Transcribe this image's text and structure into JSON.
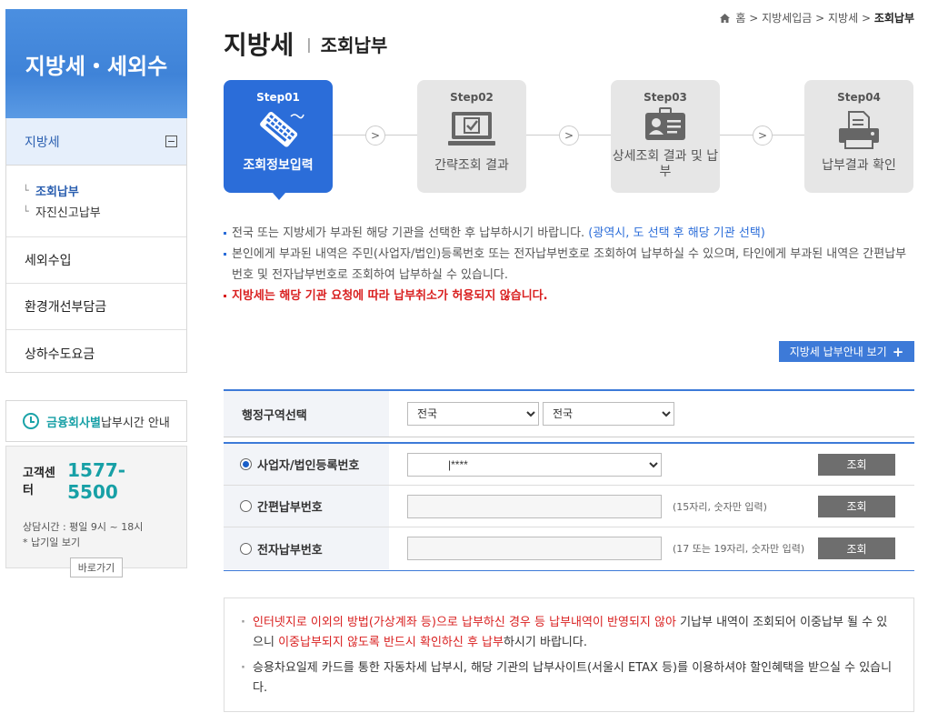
{
  "sidebar": {
    "heading": "지방세・세외수",
    "main_item": "지방세",
    "sub_items": [
      "조회납부",
      "자진신고납부"
    ],
    "links": [
      "세외수입",
      "환경개선부담금",
      "상하수도요금"
    ],
    "notice_strong": "금융회사별",
    "notice_rest": " 납부시간 안내",
    "cs_label": "고객센터",
    "cs_phone": "1577-5500",
    "cs_hours": "상담시간 : 평일 9시 ~ 18시",
    "cs_holiday": "* 납기일 보기",
    "cs_button": "바로가기"
  },
  "breadcrumb": {
    "home": "홈",
    "sep": " > ",
    "items": [
      "지방세입금",
      "지방세"
    ],
    "current": "조회납부"
  },
  "title": {
    "main": "지방세",
    "sub": "조회납부"
  },
  "steps": [
    {
      "label": "Step01",
      "name": "조회정보입력"
    },
    {
      "label": "Step02",
      "name": "간략조회 결과"
    },
    {
      "label": "Step03",
      "name": "상세조회 결과 및 납부"
    },
    {
      "label": "Step04",
      "name": "납부결과 확인"
    }
  ],
  "info": {
    "line1_a": "전국 또는 지방세가 부과된 해당 기관을 선택한 후 납부하시기 바랍니다. ",
    "line1_b": "(광역시, 도 선택 후 해당 기관 선택)",
    "line2": "본인에게 부과된 내역은 주민(사업자/법인)등록번호 또는 전자납부번호로 조회하여 납부하실 수 있으며, 타인에게 부과된 내역은 간편납부번호 및 전자납부번호로 조회하여 납부하실 수 있습니다.",
    "line3": "지방세는 해당 기관 요청에 따라 납부취소가 허용되지 않습니다."
  },
  "guide_button": "지방세 납부안내 보기",
  "region": {
    "label": "행정구역선택",
    "select1": "전국",
    "select2": "전국"
  },
  "lookup": {
    "rows": [
      {
        "label": "사업자/법인등록번호",
        "value": "|****",
        "hint": "",
        "button": "조회"
      },
      {
        "label": "간편납부번호",
        "value": "",
        "hint": "(15자리, 숫자만 입력)",
        "button": "조회"
      },
      {
        "label": "전자납부번호",
        "value": "",
        "hint": "(17 또는 19자리, 숫자만 입력)",
        "button": "조회"
      }
    ]
  },
  "caution": {
    "c1_red1": "인터넷지로 이외의 방법(가상계좌 등)으로 납부하신 경우 등 납부내역이 반영되지 않아",
    "c1_mid": " 기납부 내역이 조회되어 이중납부 될 수 있으니 ",
    "c1_red2": "이중납부되지 않도록 반드시 확인하신 후 납부",
    "c1_end": "하시기 바랍니다.",
    "c2": "승용차요일제 카드를 통한 자동차세 납부시, 해당 기관의 납부사이트(서울시 ETAX 등)를 이용하셔야 할인혜택을 받으실 수 있습니다."
  },
  "colors": {
    "accent": "#2b6dd9",
    "teal": "#17a0a6",
    "warning": "#d92020"
  }
}
